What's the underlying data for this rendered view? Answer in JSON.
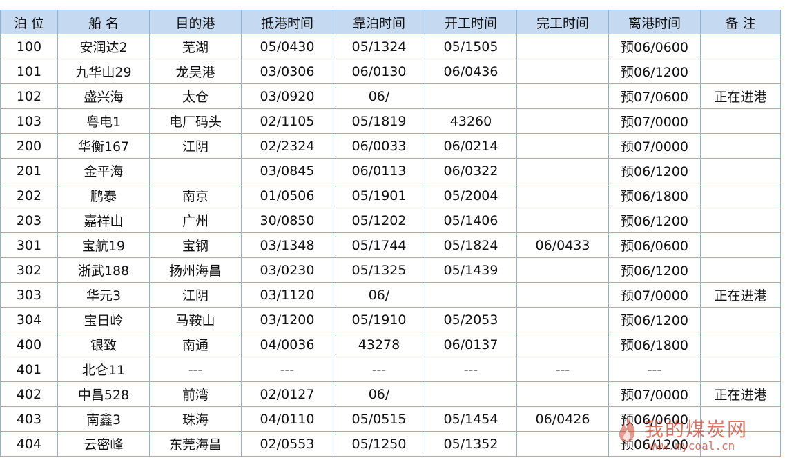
{
  "table": {
    "headers": [
      "泊 位",
      "船 名",
      "目的港",
      "抵港时间",
      "靠泊时间",
      "开工时间",
      "完工时间",
      "离港时间",
      "备 注"
    ],
    "rows": [
      [
        "100",
        "安润达2",
        "芜湖",
        "05/0430",
        "05/1324",
        "05/1505",
        "",
        "预06/0600",
        ""
      ],
      [
        "101",
        "九华山29",
        "龙吴港",
        "03/0306",
        "06/0130",
        "06/0436",
        "",
        "预06/1200",
        ""
      ],
      [
        "102",
        "盛兴海",
        "太仓",
        "03/0920",
        "06/",
        "",
        "",
        "预07/0600",
        "正在进港"
      ],
      [
        "103",
        "粤电1",
        "电厂码头",
        "02/1105",
        "05/1819",
        "43260",
        "",
        "预07/0000",
        ""
      ],
      [
        "200",
        "华衡167",
        "江阴",
        "02/2324",
        "06/0033",
        "06/0214",
        "",
        "预07/0000",
        ""
      ],
      [
        "201",
        "金平海",
        "",
        "03/0845",
        "06/0113",
        "06/0322",
        "",
        "预06/1200",
        ""
      ],
      [
        "202",
        "鹏泰",
        "南京",
        "01/0506",
        "05/1901",
        "05/2004",
        "",
        "预06/1800",
        ""
      ],
      [
        "203",
        "嘉祥山",
        "广州",
        "30/0850",
        "05/1202",
        "05/1406",
        "",
        "预06/1200",
        ""
      ],
      [
        "301",
        "宝航19",
        "宝钢",
        "03/1348",
        "05/1744",
        "05/1824",
        "06/0433",
        "预06/0600",
        ""
      ],
      [
        "302",
        "浙武188",
        "扬州海昌",
        "03/0230",
        "05/1325",
        "05/1439",
        "",
        "预06/1200",
        ""
      ],
      [
        "303",
        "华元3",
        "江阴",
        "03/1120",
        "06/",
        "",
        "",
        "预07/0000",
        "正在进港"
      ],
      [
        "304",
        "宝日岭",
        "马鞍山",
        "03/1200",
        "05/1910",
        "05/2053",
        "",
        "预06/1200",
        ""
      ],
      [
        "400",
        "银致",
        "南通",
        "04/0036",
        "43278",
        "06/0137",
        "",
        "预06/1800",
        ""
      ],
      [
        "401",
        "北仑11",
        "---",
        "---",
        "---",
        "---",
        "---",
        "---",
        ""
      ],
      [
        "402",
        "中昌528",
        "前湾",
        "02/0127",
        "06/",
        "",
        "",
        "预07/0000",
        "正在进港"
      ],
      [
        "403",
        "南鑫3",
        "珠海",
        "04/0110",
        "05/0515",
        "05/1454",
        "06/0426",
        "预06/0600",
        ""
      ],
      [
        "404",
        "云密峰",
        "东莞海昌",
        "02/0553",
        "05/1250",
        "05/1352",
        "",
        "预06/1200",
        ""
      ]
    ]
  },
  "watermark": {
    "title": "我的煤炭网",
    "url": "www.mycoal.cn",
    "color": "#cd4632"
  },
  "colors": {
    "header_bg": "#c5d9f1",
    "border": "#8fb0d9"
  }
}
